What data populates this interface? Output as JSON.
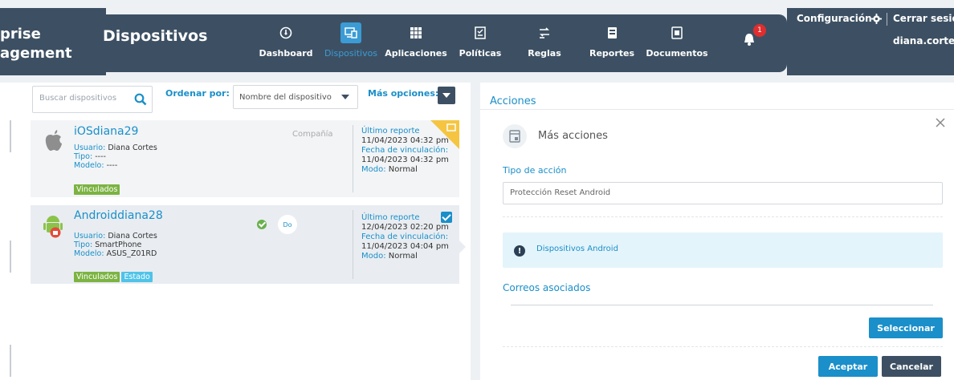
{
  "brand": {
    "line1": "prise",
    "line2": "agement"
  },
  "header": {
    "title": "Dispositivos",
    "nav": [
      {
        "label": "Dashboard",
        "icon": "dashboard-icon"
      },
      {
        "label": "Dispositivos",
        "icon": "devices-icon",
        "active": true
      },
      {
        "label": "Aplicaciones",
        "icon": "apps-grid-icon"
      },
      {
        "label": "Políticas",
        "icon": "policies-icon"
      },
      {
        "label": "Reglas",
        "icon": "rules-icon"
      },
      {
        "label": "Reportes",
        "icon": "reports-icon"
      },
      {
        "label": "Documentos",
        "icon": "documents-icon"
      }
    ],
    "notifications_count": "1",
    "config_label": "Configuración",
    "logout_label": "Cerrar sesión",
    "user": "diana.cortes"
  },
  "toolbar": {
    "search_placeholder": "Buscar dispositivos",
    "sort_label": "Ordenar por:",
    "sort_value": "Nombre del dispositivo",
    "more_options_label": "Más opciones:"
  },
  "devices": [
    {
      "name": "iOSdiana29",
      "os": "ios",
      "user_key": "Usuario:",
      "user": "Diana Cortes",
      "type_key": "Tipo:",
      "type": "----",
      "model_key": "Modelo:",
      "model": "----",
      "tags": [
        "Vinculados"
      ],
      "owner": "Compañía",
      "last_report_key": "Último reporte",
      "last_report": "11/04/2023 04:32 pm",
      "link_date_key": "Fecha de vinculación:",
      "link_date": "11/04/2023 04:32 pm",
      "mode_key": "Modo:",
      "mode": "Normal"
    },
    {
      "name": "Androiddiana28",
      "os": "android",
      "user_key": "Usuario:",
      "user": "Diana Cortes",
      "type_key": "Tipo:",
      "type": "SmartPhone",
      "model_key": "Modelo:",
      "model": "ASUS_Z01RD",
      "tags": [
        "Vinculados",
        "Estado"
      ],
      "badge": "Do",
      "last_report_key": "Último reporte",
      "last_report": "12/04/2023 02:20 pm",
      "link_date_key": "Fecha de vinculación:",
      "link_date": "11/04/2023 04:04 pm",
      "mode_key": "Modo:",
      "mode": "Normal",
      "selected": true
    }
  ],
  "actions": {
    "title": "Acciones",
    "more_actions": "Más acciones",
    "action_type_label": "Tipo de acción",
    "action_type_value": "Protección Reset Android",
    "info": "Dispositivos Android",
    "emails_label": "Correos asociados",
    "select_button": "Seleccionar",
    "accept_button": "Aceptar",
    "cancel_button": "Cancelar"
  },
  "colors": {
    "header": "#3d5063",
    "accent": "#1a8fc9",
    "tag_green": "#7cb342",
    "tag_blue": "#4fc3e8",
    "flag": "#f5c542",
    "notification": "#e02d2d"
  }
}
